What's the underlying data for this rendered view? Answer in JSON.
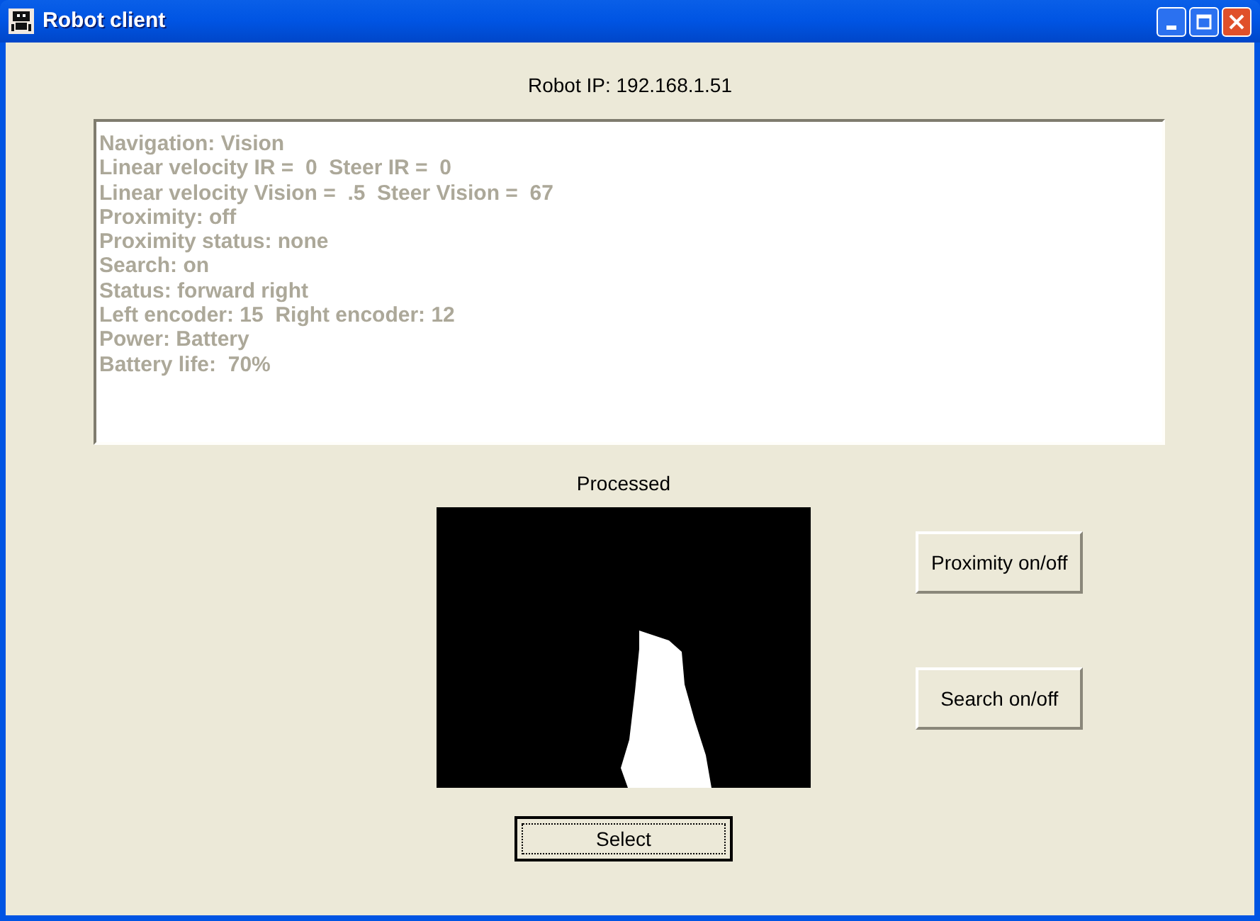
{
  "window": {
    "title": "Robot client"
  },
  "ip_label": "Robot IP: 192.168.1.51",
  "status_box": {
    "disabled": true,
    "lines": [
      "Navigation: Vision",
      "Linear velocity IR =  0  Steer IR =  0",
      "Linear velocity Vision =  .5  Steer Vision =  67",
      "Proximity: off",
      "Proximity status: none",
      "Search: on",
      "Status: forward right",
      "Left encoder: 15  Right encoder: 12",
      "Power: Battery",
      "Battery life:  70%"
    ]
  },
  "image_panel": {
    "label": "Processed",
    "button": {
      "label": "Select",
      "focused": true
    }
  },
  "buttons": [
    {
      "label": "Proximity on/off",
      "focused": false
    },
    {
      "label": "Search on/off",
      "focused": false
    }
  ]
}
